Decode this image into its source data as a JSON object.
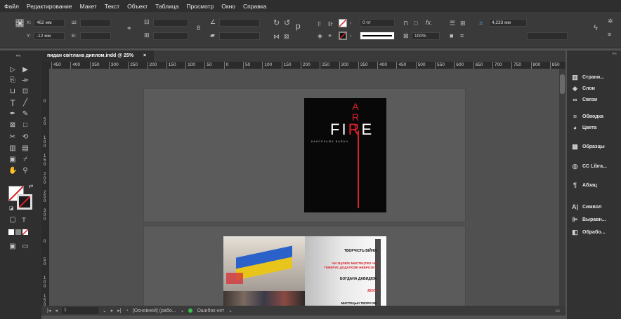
{
  "menu": [
    "Файл",
    "Редактирование",
    "Макет",
    "Текст",
    "Объект",
    "Таблица",
    "Просмотр",
    "Окно",
    "Справка"
  ],
  "control": {
    "x_label": "X:",
    "x_value": "462 мм",
    "y_label": "Y:",
    "y_value": "-12 мм",
    "w_label": "Ш:",
    "h_label": "В:",
    "stroke_value": "0 пт",
    "zoom_value": "100%",
    "gap_value": "4,233 мм"
  },
  "tab": {
    "title": "пидан світлана диплом.indd @ 25%",
    "close": "×"
  },
  "ruler_h": [
    "450",
    "400",
    "350",
    "300",
    "250",
    "200",
    "150",
    "100",
    "50",
    "0",
    "50",
    "100",
    "150",
    "200",
    "250",
    "300",
    "350",
    "400",
    "450",
    "500",
    "550",
    "600",
    "650",
    "700",
    "750",
    "800",
    "850"
  ],
  "ruler_v": [
    {
      "text": "0"
    },
    {
      "text": "5 0"
    },
    {
      "text": "1 0 0"
    },
    {
      "text": "1 5 0"
    },
    {
      "text": "2 0 0"
    },
    {
      "text": "2 5 0"
    },
    {
      "text": "3 0 0"
    }
  ],
  "ruler_v2": [
    {
      "text": "0"
    },
    {
      "text": "5 0"
    },
    {
      "text": "1 0 0"
    },
    {
      "text": "1 5 0"
    }
  ],
  "cover": {
    "title_left": "FI",
    "title_mid": "R",
    "title_right": "E",
    "vertical": "ART",
    "author": "КАНСЕЛЬЮК ВАЙАН"
  },
  "page2": {
    "lines": [
      "ТВОРЧІСТЬ ВІЙНИ",
      "ЧИ ЗЦІЛЮЄ МИСТЕЦТВО ЧИ ГЕНЕРУЄ ДОДАТКОВІ НЕВРОЗИ?",
      "БОГДАНА ДАВИДЮК",
      "ZEVS",
      "МИСТЕЦЬКІ ТВОРИ ЯК"
    ]
  },
  "status": {
    "page": "1",
    "style": "[Основной] (рабо...",
    "errors": "Ошибок нет"
  },
  "panels": [
    "Страни...",
    "Слои",
    "Связи",
    "Обводка",
    "Цвета",
    "Образцы",
    "CC Libra...",
    "Абзац",
    "Символ",
    "Выравн...",
    "Обрабо..."
  ],
  "colors": {
    "cover_red": "#d8202a",
    "menubar": "#2e2e2e",
    "canvas": "#505050"
  }
}
